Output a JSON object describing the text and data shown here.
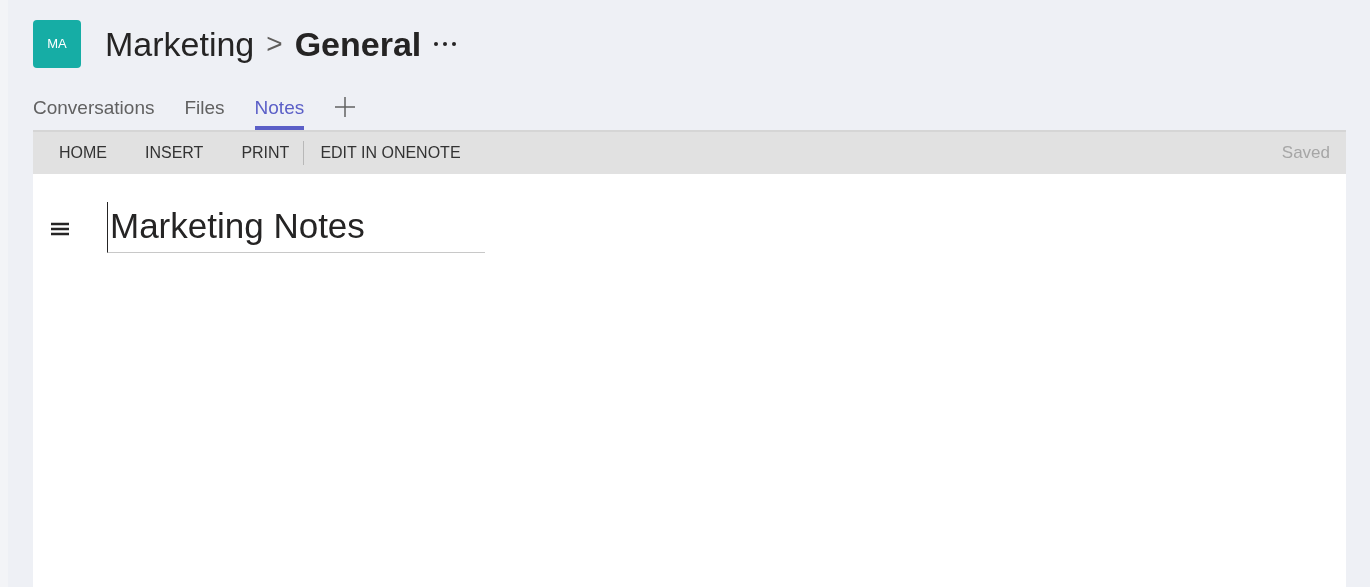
{
  "header": {
    "avatar": "MA",
    "team": "Marketing",
    "separator": ">",
    "channel": "General"
  },
  "tabs": [
    {
      "label": "Conversations",
      "selected": false
    },
    {
      "label": "Files",
      "selected": false
    },
    {
      "label": "Notes",
      "selected": true
    }
  ],
  "toolbar": {
    "groups": [
      [
        "HOME",
        "INSERT",
        "PRINT"
      ],
      [
        "EDIT IN ONENOTE"
      ]
    ],
    "status": "Saved"
  },
  "page": {
    "title": "Marketing Notes"
  }
}
